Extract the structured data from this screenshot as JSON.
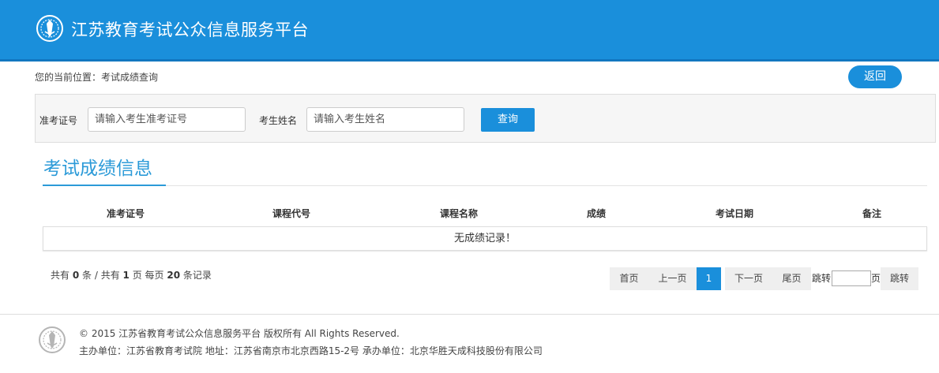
{
  "header": {
    "site_title": "江苏教育考试公众信息服务平台",
    "logo_icon": "exam-emblem-icon"
  },
  "breadcrumb": {
    "text": "您的当前位置：考试成绩查询"
  },
  "back_button": "返回",
  "search": {
    "ticket_label": "准考证号",
    "ticket_placeholder": "请输入考生准考证号",
    "ticket_value": "",
    "name_label": "考生姓名",
    "name_placeholder": "请输入考生姓名",
    "name_value": "",
    "query_button": "查询"
  },
  "section": {
    "title": "考试成绩信息"
  },
  "table": {
    "headers": [
      "准考证号",
      "课程代号",
      "课程名称",
      "成绩",
      "考试日期",
      "备注"
    ],
    "empty_message": "无成绩记录！"
  },
  "summary": {
    "prefix": "共有",
    "total_records": "0",
    "records_unit": "条 / 共有",
    "total_pages": "1",
    "per_page_prefix": "页 每页",
    "per_page": "20",
    "per_page_suffix": "条记录"
  },
  "pager": {
    "first": "首页",
    "prev": "上一页",
    "current": "1",
    "next": "下一页",
    "last": "尾页",
    "jump_label": "跳转",
    "page_label": "页",
    "go": "跳转",
    "jump_value": ""
  },
  "footer": {
    "copyright": "© 2015 江苏省教育考试公众信息服务平台 版权所有 All Rights Reserved.",
    "organizer": "主办单位：江苏省教育考试院 地址：江苏省南京市北京西路15-2号 承办单位：北京华胜天成科技股份有限公司"
  },
  "colors": {
    "brand_blue": "#1a8fdb",
    "title_blue": "#2b9ad8"
  }
}
